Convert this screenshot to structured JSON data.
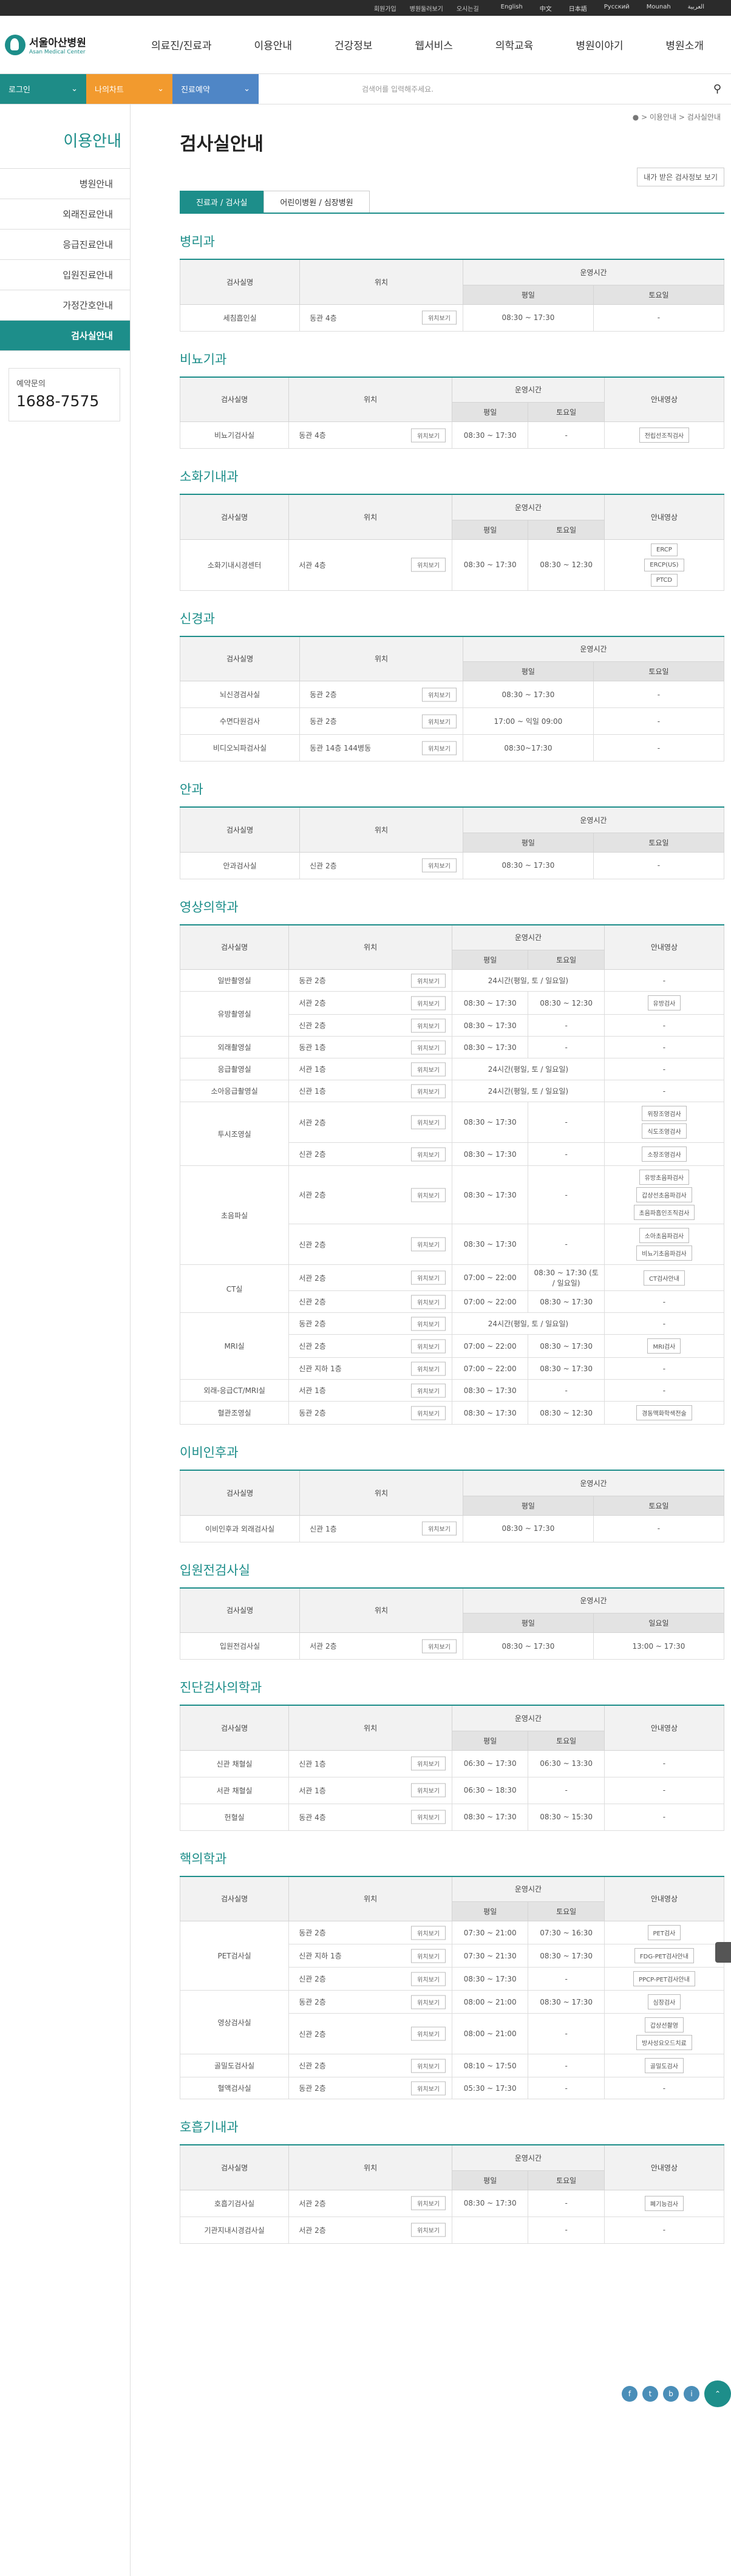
{
  "top": {
    "links": [
      "회원가입",
      "병원둘러보기",
      "오시는길"
    ],
    "langs": [
      "English",
      "中文",
      "日本語",
      "Русский",
      "Mounah",
      "العربية"
    ]
  },
  "logo": {
    "ko": "서울아산병원",
    "en": "Asan Medical Center"
  },
  "gnb": [
    "의료진/진료과",
    "이용안내",
    "건강정보",
    "웹서비스",
    "의학교육",
    "병원이야기",
    "병원소개"
  ],
  "sub": {
    "login": "로그인",
    "my": "나의차트",
    "res": "진료예약",
    "search_placeholder": "검색어를 입력해주세요."
  },
  "lnb": {
    "title": "이용안내",
    "items": [
      "병원안내",
      "외래진료안내",
      "응급진료안내",
      "입원진료안내",
      "가정간호안내",
      "검사실안내"
    ],
    "call_label": "예약문의",
    "call_number": "1688-7575"
  },
  "page": {
    "breadcrumb": "● > 이용안내 > 검사실안내",
    "title": "검사실안내",
    "help_btn": "내가 받은 검사정보 보기",
    "tabs": [
      "진료과 / 검사실",
      "어린이병원 / 심장병원"
    ]
  },
  "labels": {
    "room": "검사실명",
    "loc": "위치",
    "hours": "운영시간",
    "weekday": "평일",
    "saturday": "토요일",
    "video": "안내영상",
    "map": "위치보기",
    "holiday": "일요일"
  },
  "sections": [
    {
      "title": "병리과",
      "rows": [
        {
          "name": "세침흡인실",
          "loc": "동관 4층",
          "wd": "08:30 ~ 17:30",
          "sat": "-"
        }
      ]
    },
    {
      "title": "비뇨기과",
      "rows": [
        {
          "name": "비뇨기검사실",
          "loc": "동관 4층",
          "wd": "08:30 ~ 17:30",
          "sat": "-",
          "vid": [
            "전립선조직검사"
          ]
        }
      ]
    },
    {
      "title": "소화기내과",
      "rows": [
        {
          "name": "소화기내시경센터",
          "loc": "서관 4층",
          "wd": "08:30 ~ 17:30",
          "sat": "08:30 ~ 12:30",
          "vid": [
            "ERCP",
            "ERCP(US)",
            "PTCD"
          ]
        }
      ]
    },
    {
      "title": "신경과",
      "rows": [
        {
          "name": "뇌신경검사실",
          "loc": "동관 2층",
          "wd": "08:30 ~ 17:30",
          "sat": "-"
        },
        {
          "name": "수면다원검사",
          "loc": "동관 2층",
          "wd": "17:00 ~ 익일 09:00",
          "sat": "-"
        },
        {
          "name": "비디오뇌파검사실",
          "loc": "동관 14층 144병동",
          "wd": "08:30~17:30",
          "sat": "-"
        }
      ]
    },
    {
      "title": "안과",
      "rows": [
        {
          "name": "안과검사실",
          "loc": "신관 2층",
          "wd": "08:30 ~ 17:30",
          "sat": "-"
        }
      ]
    },
    {
      "title": "영상의학과",
      "rows": [
        {
          "name": "일반촬영실",
          "loc": "동관 2층",
          "wd": "24시간(평일, 토 / 일요일)",
          "sat": "",
          "vid": []
        },
        {
          "name": "유방촬영실",
          "loc": "서관 2층",
          "wd": "08:30 ~ 17:30",
          "sat": "08:30 ~ 12:30",
          "vid": [
            "유방검사"
          ]
        },
        {
          "name": "",
          "loc": "신관 2층",
          "wd": "08:30 ~ 17:30",
          "sat": "-",
          "vid": []
        },
        {
          "name": "외래촬영실",
          "loc": "동관 1층",
          "wd": "08:30 ~ 17:30",
          "sat": "-",
          "vid": []
        },
        {
          "name": "응급촬영실",
          "loc": "서관 1층",
          "wd": "24시간(평일, 토 / 일요일)",
          "sat": "",
          "vid": []
        },
        {
          "name": "소아응급촬영실",
          "loc": "신관 1층",
          "wd": "24시간(평일, 토 / 일요일)",
          "sat": "",
          "vid": []
        },
        {
          "name": "투시조영실",
          "loc": "서관 2층",
          "wd": "08:30 ~ 17:30",
          "sat": "-",
          "vid": [
            "위장조영검사",
            "식도조영검사"
          ]
        },
        {
          "name": "",
          "loc": "신관 2층",
          "wd": "08:30 ~ 17:30",
          "sat": "-",
          "vid": [
            "소장조영검사"
          ]
        },
        {
          "name": "초음파실",
          "loc": "서관 2층",
          "wd": "08:30 ~ 17:30",
          "sat": "-",
          "vid": [
            "유방초음파검사",
            "갑상선초음파검사",
            "초음파흡인조직검사"
          ]
        },
        {
          "name": "",
          "loc": "신관 2층",
          "wd": "08:30 ~ 17:30",
          "sat": "-",
          "vid": [
            "소아초음파검사",
            "비뇨기초음파검사"
          ]
        },
        {
          "name": "CT실",
          "loc": "서관 2층",
          "wd": "07:00 ~ 22:00",
          "sat": "08:30 ~ 17:30 (토 / 일요일)",
          "vid": [
            "CT검사안내"
          ]
        },
        {
          "name": "",
          "loc": "신관 2층",
          "wd": "07:00 ~ 22:00",
          "sat": "08:30 ~ 17:30",
          "vid": []
        },
        {
          "name": "MRI실",
          "loc": "동관 2층",
          "wd": "24시간(평일, 토 / 일요일)",
          "sat": "",
          "vid": []
        },
        {
          "name": "",
          "loc": "신관 2층",
          "wd": "07:00 ~ 22:00",
          "sat": "08:30 ~ 17:30",
          "vid": [
            "MRI검사"
          ]
        },
        {
          "name": "",
          "loc": "신관 지하 1층",
          "wd": "07:00 ~ 22:00",
          "sat": "08:30 ~ 17:30",
          "vid": []
        },
        {
          "name": "외래-응급CT/MRI실",
          "loc": "서관 1층",
          "wd": "08:30 ~ 17:30",
          "sat": "-",
          "vid": []
        },
        {
          "name": "혈관조영실",
          "loc": "동관 2층",
          "wd": "08:30 ~ 17:30",
          "sat": "08:30 ~ 12:30",
          "vid": [
            "경동맥화학색전술"
          ]
        }
      ]
    },
    {
      "title": "이비인후과",
      "rows": [
        {
          "name": "이비인후과 외래검사실",
          "loc": "신관 1층",
          "wd": "08:30 ~ 17:30",
          "sat": "-"
        }
      ]
    },
    {
      "title": "입원전검사실",
      "rows": [
        {
          "name": "입원전검사실",
          "loc": "서관 2층",
          "wd": "08:30 ~ 17:30",
          "sat": "13:00 ~ 17:30"
        }
      ]
    },
    {
      "title": "진단검사의학과",
      "rows": [
        {
          "name": "신관 채혈실",
          "loc": "신관 1층",
          "wd": "06:30 ~ 17:30",
          "sat": "06:30 ~ 13:30",
          "vid": []
        },
        {
          "name": "서관 채혈실",
          "loc": "서관 1층",
          "wd": "06:30 ~ 18:30",
          "sat": "-",
          "vid": []
        },
        {
          "name": "헌혈실",
          "loc": "동관 4층",
          "wd": "08:30 ~ 17:30",
          "sat": "08:30 ~ 15:30",
          "vid": []
        }
      ]
    },
    {
      "title": "핵의학과",
      "rows": [
        {
          "name": "PET검사실",
          "loc": "동관 2층",
          "wd": "07:30 ~ 21:00",
          "sat": "07:30 ~ 16:30",
          "vid": [
            "PET검사"
          ]
        },
        {
          "name": "",
          "loc": "신관 지하 1층",
          "wd": "07:30 ~ 21:30",
          "sat": "08:30 ~ 17:30",
          "vid": [
            "FDG-PET검사안내"
          ]
        },
        {
          "name": "",
          "loc": "신관 2층",
          "wd": "08:30 ~ 17:30",
          "sat": "-",
          "vid": [
            "PPCP-PET검사안내"
          ]
        },
        {
          "name": "영상검사실",
          "loc": "동관 2층",
          "wd": "08:00 ~ 21:00",
          "sat": "08:30 ~ 17:30",
          "vid": [
            "심장검사"
          ]
        },
        {
          "name": "",
          "loc": "신관 2층",
          "wd": "08:00 ~ 21:00",
          "sat": "-",
          "vid": [
            "갑상선촬영",
            "방사성요오드치료"
          ]
        },
        {
          "name": "골밀도검사실",
          "loc": "신관 2층",
          "wd": "08:10 ~ 17:50",
          "sat": "-",
          "vid": [
            "골밀도검사"
          ]
        },
        {
          "name": "혈액검사실",
          "loc": "동관 2층",
          "wd": "05:30 ~ 17:30",
          "sat": "-",
          "vid": []
        }
      ]
    },
    {
      "title": "호흡기내과",
      "rows": [
        {
          "name": "호흡기검사실",
          "loc": "서관 2층",
          "wd": "08:30 ~ 17:30",
          "sat": "-",
          "vid": [
            "폐기능검사"
          ]
        },
        {
          "name": "기관지내시경검사실",
          "loc": "서관 2층",
          "wd": "",
          "sat": "-",
          "vid": []
        }
      ]
    }
  ],
  "sns": [
    "f",
    "t",
    "b",
    "i"
  ]
}
